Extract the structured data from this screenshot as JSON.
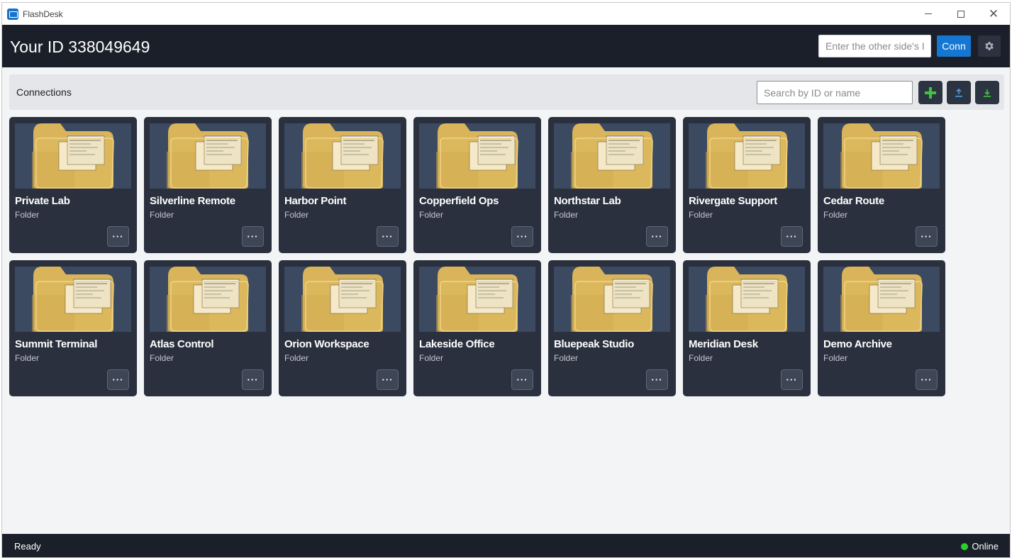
{
  "window": {
    "title": "FlashDesk"
  },
  "header": {
    "your_id": "Your ID 338049649",
    "peer_input_placeholder": "Enter the other side's ID",
    "connect_label": "Conn"
  },
  "connections": {
    "title": "Connections",
    "search_placeholder": "Search by ID or name"
  },
  "cards": [
    {
      "name": "Private Lab",
      "type": "Folder"
    },
    {
      "name": "Silverline Remote",
      "type": "Folder"
    },
    {
      "name": "Harbor Point",
      "type": "Folder"
    },
    {
      "name": "Copperfield Ops",
      "type": "Folder"
    },
    {
      "name": "Northstar Lab",
      "type": "Folder"
    },
    {
      "name": "Rivergate Support",
      "type": "Folder"
    },
    {
      "name": "Cedar Route",
      "type": "Folder"
    },
    {
      "name": "Summit Terminal",
      "type": "Folder"
    },
    {
      "name": "Atlas Control",
      "type": "Folder"
    },
    {
      "name": "Orion Workspace",
      "type": "Folder"
    },
    {
      "name": "Lakeside Office",
      "type": "Folder"
    },
    {
      "name": "Bluepeak Studio",
      "type": "Folder"
    },
    {
      "name": "Meridian Desk",
      "type": "Folder"
    },
    {
      "name": "Demo Archive",
      "type": "Folder"
    }
  ],
  "card_more_label": "···",
  "status": {
    "text": "Ready",
    "online_label": "Online"
  },
  "colors": {
    "header_bg": "#1b1f29",
    "card_bg": "#2a303d",
    "folder": "#e3bf62",
    "accent": "#1677d2",
    "online": "#2bd12b"
  },
  "icons": [
    "app-icon",
    "gear-icon",
    "plus-icon",
    "import-icon",
    "export-icon",
    "folder-icon",
    "more-icon"
  ]
}
